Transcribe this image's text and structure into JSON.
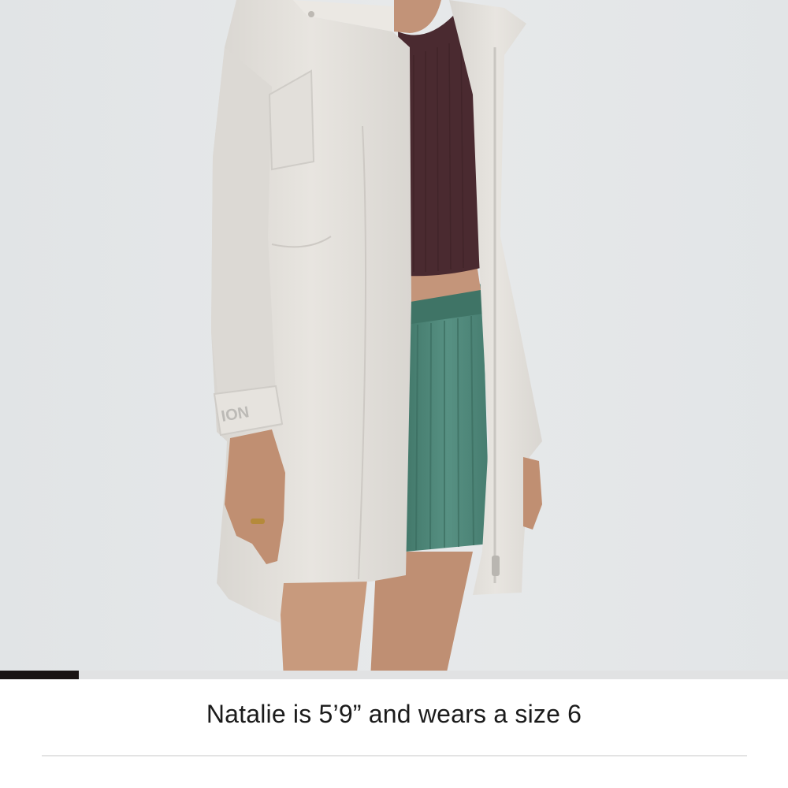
{
  "product_image": {
    "alt_icon": "product-photo",
    "sleeve_mark": "ION",
    "colors": {
      "background": "#e4e6e8",
      "jacket": "#e3e0db",
      "top": "#4a2a30",
      "skirt": "#4f8677",
      "skin": "#c89a7d"
    }
  },
  "gallery_progress": {
    "current": 1,
    "fraction": 0.1,
    "color": "#1a1414"
  },
  "caption": {
    "text": "Natalie is 5’9” and wears a size 6"
  }
}
